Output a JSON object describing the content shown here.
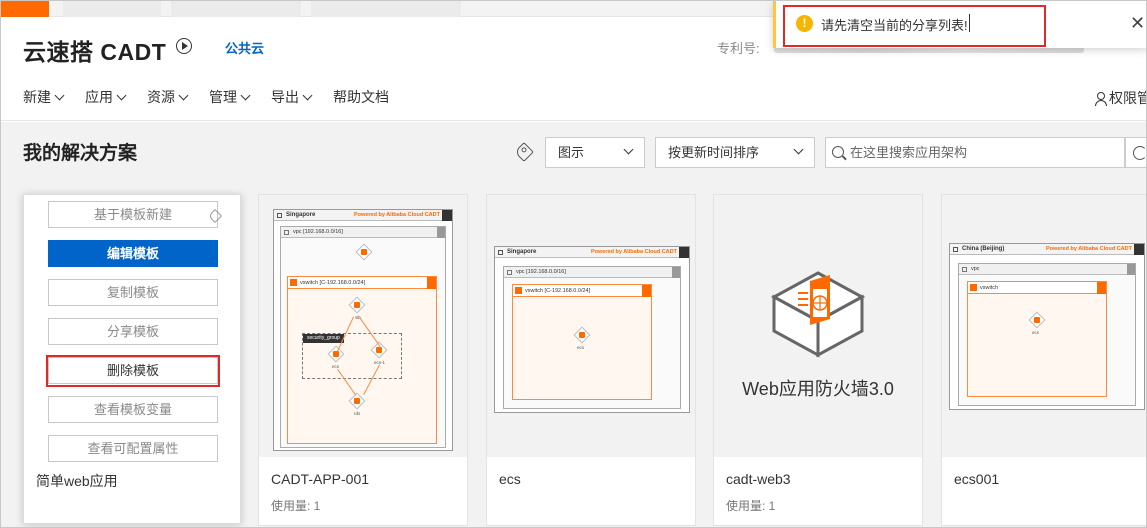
{
  "header": {
    "app_title": "云速搭 CADT",
    "cloud_link": "公共云",
    "patent_label": "专利号:",
    "permission": "权限管"
  },
  "menu": [
    {
      "label": "新建",
      "has_dropdown": true
    },
    {
      "label": "应用",
      "has_dropdown": true
    },
    {
      "label": "资源",
      "has_dropdown": true
    },
    {
      "label": "管理",
      "has_dropdown": true
    },
    {
      "label": "导出",
      "has_dropdown": true
    },
    {
      "label": "帮助文档",
      "has_dropdown": false
    }
  ],
  "toast": {
    "icon": "warning-icon",
    "message": "请先清空当前的分享列表!",
    "accent_color": "#ffc440"
  },
  "toolbar": {
    "section_title": "我的解决方案",
    "view_select": "图示",
    "sort_select": "按更新时间排序",
    "search_placeholder": "在这里搜索应用架构"
  },
  "first_card": {
    "name": "简单web应用",
    "actions": [
      "基于模板新建",
      "编辑模板",
      "复制模板",
      "分享模板",
      "删除模板",
      "查看模板变量",
      "查看可配置属性"
    ]
  },
  "cards": [
    {
      "name": "CADT-APP-001",
      "usage": "使用量: 1"
    },
    {
      "name": "ecs",
      "usage": ""
    },
    {
      "name": "cadt-web3",
      "usage": "使用量: 1",
      "thumb_text": "Web应用防火墙3.0"
    },
    {
      "name": "ecs001",
      "usage": ""
    }
  ],
  "diagrams": {
    "card1": {
      "region": "Singapore",
      "powered": "Powered by Alibaba Cloud CADT",
      "vpc": "vpc [192.168.0.0/16]",
      "vswitch": "vswitch [C-192.168.0.0/24]",
      "group": "security_group",
      "nodes": [
        "slb",
        "ecs",
        "ecs-1",
        "rds"
      ]
    },
    "card2": {
      "region": "Singapore",
      "powered": "Powered by Alibaba Cloud CADT",
      "vpc": "vpc [192.168.0.0/16]",
      "vswitch": "vswitch [C-192.168.0.0/24]",
      "node": "ecs"
    },
    "card4": {
      "region": "China (Beijing)",
      "powered": "Powered by Alibaba Cloud CADT",
      "vpc": "vpc",
      "vswitch": "vswitch",
      "node": "ecs"
    }
  },
  "colors": {
    "brand_orange": "#ff6a00",
    "primary_blue": "#0064c8",
    "highlight_red": "#e02a2a"
  }
}
